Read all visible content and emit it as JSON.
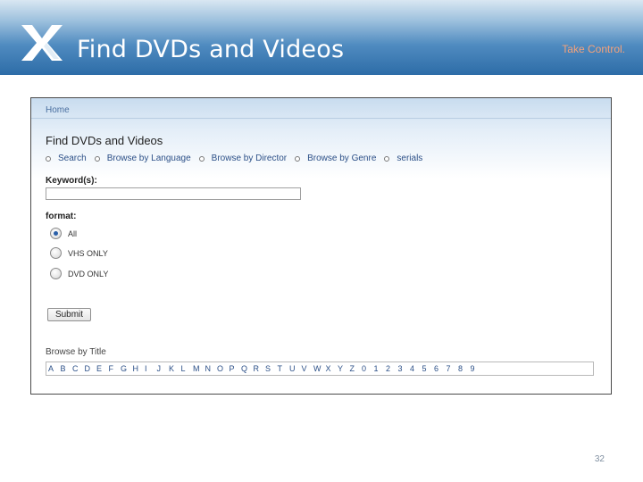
{
  "slide": {
    "title": "Find DVDs and Videos",
    "tagline": "Take Control.",
    "page_number": "32",
    "colors": {
      "header_blue": "#2d6ca7",
      "tagline_orange": "#f5a27a"
    }
  },
  "screenshot": {
    "breadcrumb": "Home",
    "page_title": "Find DVDs and Videos",
    "nav": [
      {
        "label": "Search"
      },
      {
        "label": "Browse by Language"
      },
      {
        "label": "Browse by Director"
      },
      {
        "label": "Browse by Genre"
      },
      {
        "label": "serials"
      }
    ],
    "keyword_label": "Keyword(s):",
    "keyword_value": "",
    "format_label": "format:",
    "format_options": [
      {
        "label": "All",
        "checked": true
      },
      {
        "label": "VHS ONLY",
        "checked": false
      },
      {
        "label": "DVD ONLY",
        "checked": false
      }
    ],
    "submit_label": "Submit",
    "browse_title_label": "Browse by Title",
    "browse_chars": [
      "A",
      "B",
      "C",
      "D",
      "E",
      "F",
      "G",
      "H",
      "I",
      "J",
      "K",
      "L",
      "M",
      "N",
      "O",
      "P",
      "Q",
      "R",
      "S",
      "T",
      "U",
      "V",
      "W",
      "X",
      "Y",
      "Z",
      "0",
      "1",
      "2",
      "3",
      "4",
      "5",
      "6",
      "7",
      "8",
      "9"
    ]
  }
}
